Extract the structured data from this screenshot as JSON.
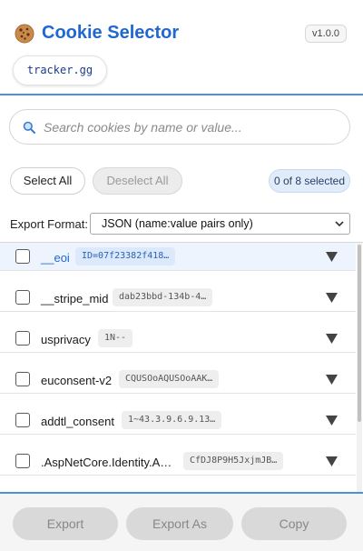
{
  "header": {
    "app_icon": "cookie-icon",
    "title": "Cookie Selector",
    "version": "v1.0.0",
    "domain": "tracker.gg"
  },
  "search": {
    "icon": "search-icon",
    "placeholder": "Search cookies by name or value...",
    "value": ""
  },
  "selection": {
    "select_all_label": "Select All",
    "deselect_all_label": "Deselect All",
    "count_label": "0 of 8 selected"
  },
  "export": {
    "label": "Export Format:",
    "selected_format": "JSON (name:value pairs only)"
  },
  "cookies": [
    {
      "name": "__eoi",
      "value": "ID=07f23382f418…",
      "checked": false
    },
    {
      "name": "__stripe_mid",
      "value": "dab23bbd-134b-4…",
      "checked": false
    },
    {
      "name": "usprivacy",
      "value": "1N--",
      "checked": false
    },
    {
      "name": "euconsent-v2",
      "value": "CQUSOoAQUSOoAAK…",
      "checked": false
    },
    {
      "name": "addtl_consent",
      "value": "1~43.3.9.6.9.13…",
      "checked": false
    },
    {
      "name": ".AspNetCore.Identity.A…",
      "value": "CfDJ8P9H5JxjmJB…",
      "checked": false
    }
  ],
  "footer": {
    "export_label": "Export",
    "export_as_label": "Export As",
    "copy_label": "Copy"
  },
  "colors": {
    "accent": "#1f67d2",
    "divider": "#4a8fe0",
    "selected_row": "#eef4fd",
    "disabled_button": "#d9d9d9"
  }
}
